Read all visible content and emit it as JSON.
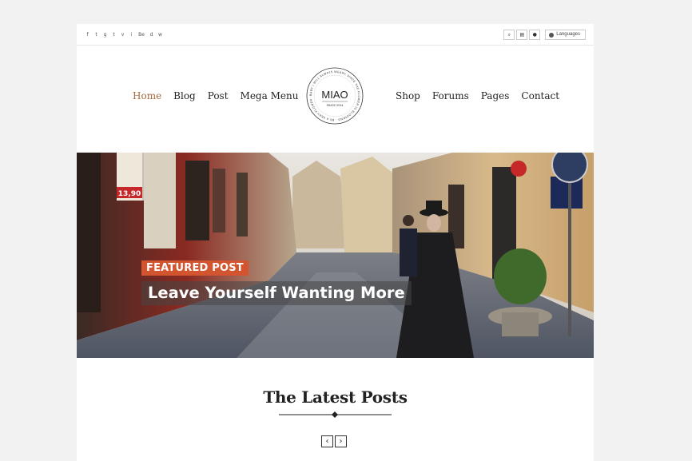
{
  "topbar": {
    "social": [
      "f",
      "t",
      "g",
      "t",
      "v",
      "i",
      "Be",
      "d",
      "w"
    ],
    "social_icons": [
      "facebook-icon",
      "twitter-icon",
      "google-plus-icon",
      "tumblr-icon",
      "vimeo-icon",
      "instagram-icon",
      "behance-icon",
      "dribbble-icon",
      "wordpress-icon"
    ],
    "tools": [
      "⌕",
      "▤",
      "●"
    ],
    "language_label": "Languages"
  },
  "logo": {
    "name": "MIAO",
    "since": "SINCE 2014"
  },
  "nav": {
    "left": [
      "Home",
      "Blog",
      "Post",
      "Mega Menu"
    ],
    "right": [
      "Shop",
      "Forums",
      "Pages",
      "Contact"
    ],
    "active": "Home",
    "active_color": "#a66a3f"
  },
  "hero": {
    "tag": "FEATURED POST",
    "title": "Leave Yourself Wanting More",
    "tag_color": "#d2552f",
    "sign_text": "13,90"
  },
  "latest": {
    "title": "The Latest Posts",
    "prev": "‹",
    "next": "›"
  }
}
